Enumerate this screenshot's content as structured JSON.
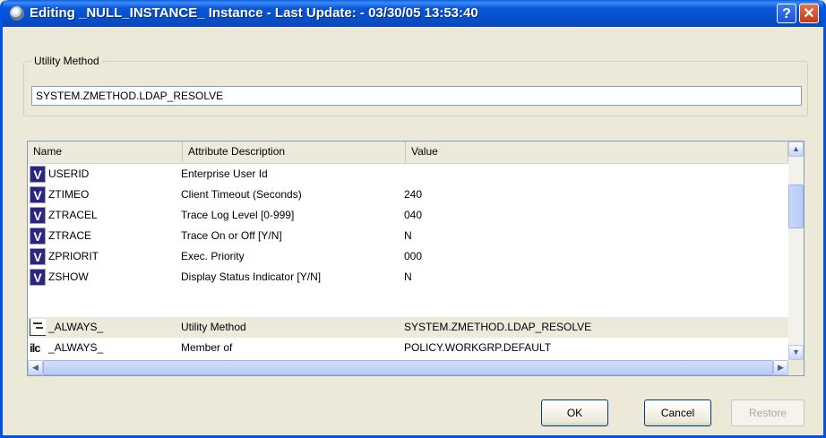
{
  "window": {
    "title": "Editing _NULL_INSTANCE_ Instance - Last Update: - 03/30/05 13:53:40",
    "help_label": "?",
    "close_label": "✕"
  },
  "utility_method": {
    "label": "Utility Method",
    "value": "SYSTEM.ZMETHOD.LDAP_RESOLVE"
  },
  "table": {
    "columns": [
      "Name",
      "Attribute Description",
      "Value"
    ],
    "rows": [
      {
        "icon": "variable-icon",
        "icon_text": "V",
        "name": "USERID",
        "description": "Enterprise User Id",
        "value": ""
      },
      {
        "icon": "variable-icon",
        "icon_text": "V",
        "name": "ZTIMEO",
        "description": "Client Timeout (Seconds)",
        "value": "240"
      },
      {
        "icon": "variable-icon",
        "icon_text": "V",
        "name": "ZTRACEL",
        "description": "Trace Log Level [0-999]",
        "value": "040"
      },
      {
        "icon": "variable-icon",
        "icon_text": "V",
        "name": "ZTRACE",
        "description": "Trace On or Off [Y/N]",
        "value": "N"
      },
      {
        "icon": "variable-icon",
        "icon_text": "V",
        "name": "ZPRIORIT",
        "description": "Exec. Priority",
        "value": "000"
      },
      {
        "icon": "variable-icon",
        "icon_text": "V",
        "name": "ZSHOW",
        "description": "Display Status Indicator [Y/N]",
        "value": "N"
      },
      {
        "icon": "method-icon",
        "icon_text": "",
        "name": "_ALWAYS_",
        "description": "Utility Method",
        "value": "SYSTEM.ZMETHOD.LDAP_RESOLVE",
        "selected": true
      },
      {
        "icon": "group-icon",
        "icon_text": "ilc",
        "name": "_ALWAYS_",
        "description": "Member of",
        "value": "POLICY.WORKGRP.DEFAULT"
      }
    ]
  },
  "buttons": {
    "ok": "OK",
    "cancel": "Cancel",
    "restore": "Restore"
  }
}
